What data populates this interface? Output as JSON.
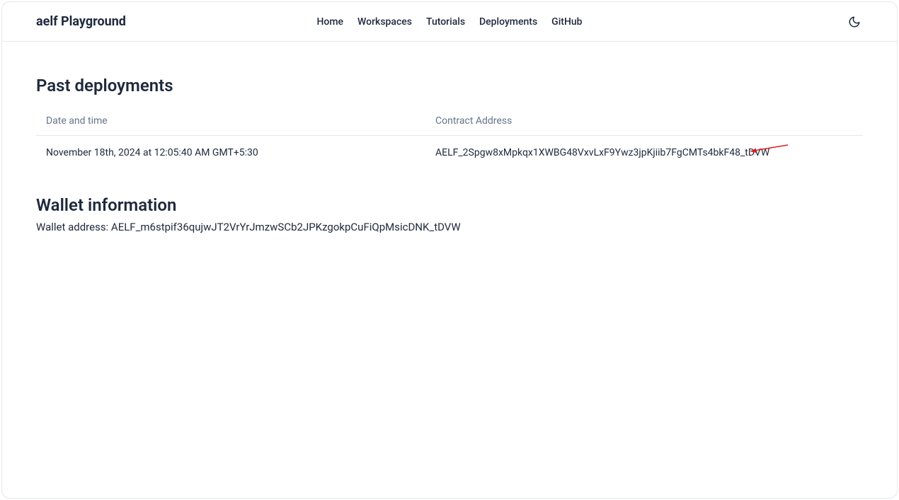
{
  "header": {
    "brand": "aelf Playground",
    "nav": [
      {
        "label": "Home"
      },
      {
        "label": "Workspaces"
      },
      {
        "label": "Tutorials"
      },
      {
        "label": "Deployments"
      },
      {
        "label": "GitHub"
      }
    ]
  },
  "deployments": {
    "title": "Past deployments",
    "columns": {
      "datetime": "Date and time",
      "address": "Contract Address"
    },
    "rows": [
      {
        "datetime": "November 18th, 2024 at 12:05:40 AM GMT+5:30",
        "address": "AELF_2Spgw8xMpkqx1XWBG48VxvLxF9Ywz3jpKjiib7FgCMTs4bkF48_tDVW"
      }
    ]
  },
  "wallet": {
    "title": "Wallet information",
    "address_label": "Wallet address: ",
    "address": "AELF_m6stpif36qujwJT2VrYrJmzwSCb2JPKzgokpCuFiQpMsicDNK_tDVW"
  }
}
